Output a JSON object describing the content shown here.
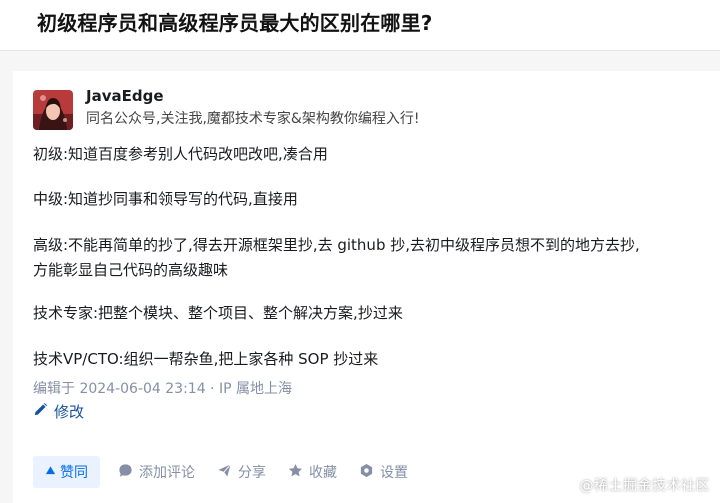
{
  "question": {
    "title": "初级程序员和高级程序员最大的区别在哪里?"
  },
  "author": {
    "name": "JavaEdge",
    "bio": "同名公众号,关注我,魔都技术专家&架构教你编程入行!"
  },
  "answer": {
    "lines": [
      "初级:知道百度参考别人代码改吧改吧,凑合用",
      "中级:知道抄同事和领导写的代码,直接用",
      "高级:不能再简单的抄了,得去开源框架里抄,去 github 抄,去初中级程序员想不到的地方去抄,",
      "方能彰显自己代码的高级趣味",
      "技术专家:把整个模块、整个项目、整个解决方案,抄过来",
      "技术VP/CTO:组织一帮杂鱼,把上家各种 SOP 抄过来"
    ]
  },
  "meta": {
    "edited": "编辑于 2024-06-04 23:14 · IP 属地上海"
  },
  "edit": {
    "label": "修改",
    "icon": "pencil-icon"
  },
  "actions": {
    "vote": {
      "label": "赞同",
      "icon": "triangle-up-icon"
    },
    "comment": {
      "label": "添加评论",
      "icon": "comment-icon"
    },
    "share": {
      "label": "分享",
      "icon": "share-icon"
    },
    "favorite": {
      "label": "收藏",
      "icon": "star-icon"
    },
    "settings": {
      "label": "设置",
      "icon": "gear-icon"
    }
  },
  "watermark": "@稀土掘金技术社区",
  "colors": {
    "accent": "#056de8",
    "vote_bg": "#eaf2ff",
    "link": "#175199",
    "muted": "#8590a6"
  }
}
